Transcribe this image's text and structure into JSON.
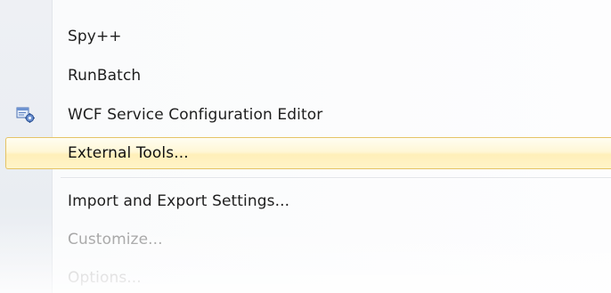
{
  "menu": {
    "items": [
      {
        "label": "Spy++",
        "state": "enabled"
      },
      {
        "label": "RunBatch",
        "state": "enabled"
      },
      {
        "label": "WCF Service Configuration Editor",
        "state": "enabled",
        "icon": "wcf-config-editor-icon"
      },
      {
        "label": "External Tools...",
        "state": "highlighted"
      },
      {
        "label": "Import and Export Settings...",
        "state": "enabled"
      },
      {
        "label": "Customize...",
        "state": "disabled"
      },
      {
        "label": "Options...",
        "state": "disabled"
      }
    ]
  },
  "colors": {
    "highlight_border": "#e5c365",
    "highlight_fill": "#fff7d6",
    "text": "#1e1e1e",
    "disabled_text": "#9b9b9b",
    "gutter": "#eef0f4"
  }
}
